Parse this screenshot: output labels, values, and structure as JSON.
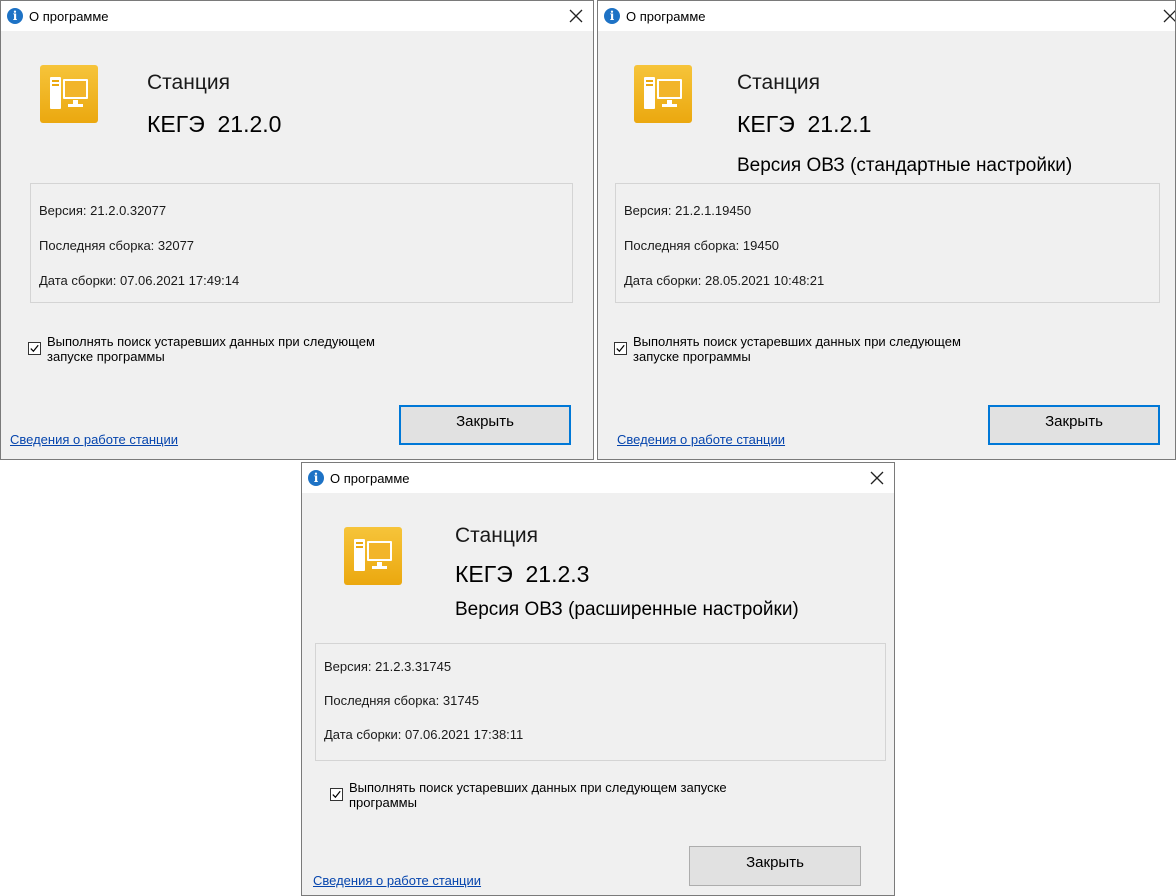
{
  "icons": {
    "title_icon": "info-icon",
    "close": "close-icon",
    "app": "computer-station-icon",
    "checkbox": "checkmark-icon"
  },
  "colors": {
    "app_icon_bg": "#f0b722",
    "link": "#0645ad",
    "focus_border": "#0078d7",
    "info_icon": "#1d72c5"
  },
  "dialogs": [
    {
      "title": "О программе",
      "product": "Станция",
      "version_title": "КЕГЭ  21.2.0",
      "edition": "",
      "info": {
        "version": "Версия: 21.2.0.32077",
        "last_build": "Последняя сборка: 32077",
        "build_date": "Дата сборки: 07.06.2021 17:49:14"
      },
      "checkbox": {
        "checked": true,
        "line1": "Выполнять поиск устаревших данных при следующем",
        "line2": "запуске программы"
      },
      "link": "Сведения о работе станции",
      "close_button": "Закрыть"
    },
    {
      "title": "О программе",
      "product": "Станция",
      "version_title": "КЕГЭ  21.2.1",
      "edition": "Версия ОВЗ (стандартные настройки)",
      "info": {
        "version": "Версия: 21.2.1.19450",
        "last_build": "Последняя сборка: 19450",
        "build_date": "Дата сборки: 28.05.2021 10:48:21"
      },
      "checkbox": {
        "checked": true,
        "line1": "Выполнять поиск устаревших данных при следующем",
        "line2": "запуске программы"
      },
      "link": "Сведения о работе станции",
      "close_button": "Закрыть"
    },
    {
      "title": "О программе",
      "product": "Станция",
      "version_title": "КЕГЭ  21.2.3",
      "edition": "Версия ОВЗ (расширенные настройки)",
      "info": {
        "version": "Версия: 21.2.3.31745",
        "last_build": "Последняя сборка: 31745",
        "build_date": "Дата сборки: 07.06.2021 17:38:11"
      },
      "checkbox": {
        "checked": true,
        "line1": "Выполнять поиск устаревших данных при следующем запуске",
        "line2": "программы"
      },
      "link": "Сведения о работе станции",
      "close_button": "Закрыть"
    }
  ]
}
